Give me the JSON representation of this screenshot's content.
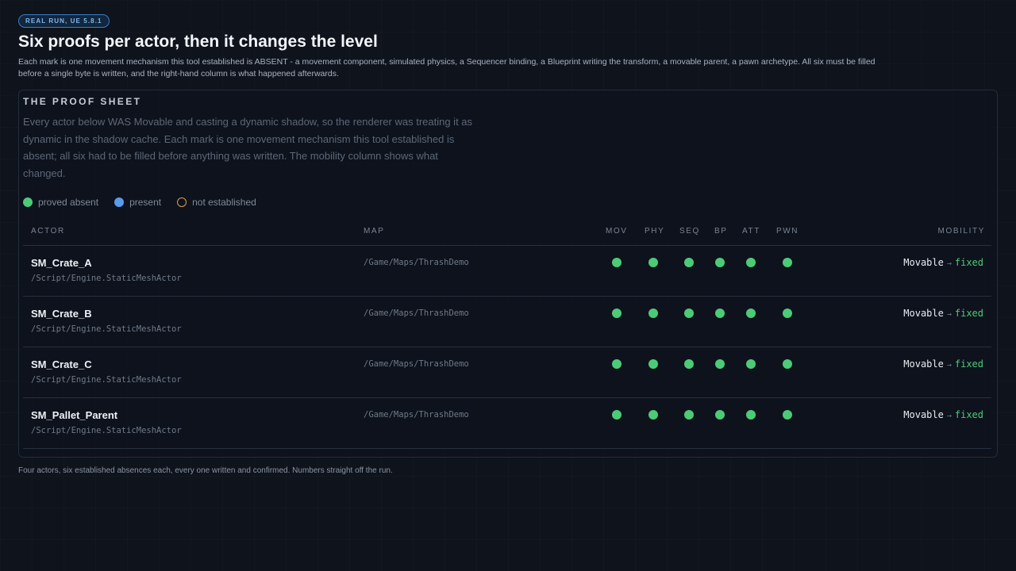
{
  "badge": "REAL RUN, UE 5.8.1",
  "title": "Six proofs per actor, then it changes the level",
  "subtitle": "Each mark is one movement mechanism this tool established is ABSENT - a movement component, simulated physics, a Sequencer binding, a Blueprint writing the transform, a movable parent, a pawn archetype. All six must be filled before a single byte is written, and the right-hand column is what happened afterwards.",
  "card": {
    "title": "THE PROOF SHEET",
    "description": "Every actor below WAS Movable and casting a dynamic shadow, so the renderer was treating it as dynamic in the shadow cache. Each mark is one movement mechanism this tool established is absent; all six had to be filled before anything was written. The mobility column shows what changed."
  },
  "legend": {
    "absent": "proved absent",
    "present": "present",
    "not_established": "not established"
  },
  "colors": {
    "absent": "#4ccb77",
    "present": "#5b9bea",
    "not_established": "#d9a04e"
  },
  "columns": {
    "actor": "ACTOR",
    "map": "MAP",
    "mov": "MOV",
    "phy": "PHY",
    "seq": "SEQ",
    "bp": "BP",
    "att": "ATT",
    "pwn": "PWN",
    "mobility": "MOBILITY"
  },
  "rows": [
    {
      "name": "SM_Crate_A",
      "class": "/Script/Engine.StaticMeshActor",
      "map": "/Game/Maps/ThrashDemo",
      "proofs": [
        "absent",
        "absent",
        "absent",
        "absent",
        "absent",
        "absent"
      ],
      "from": "Movable",
      "arrow": "→",
      "to": "fixed"
    },
    {
      "name": "SM_Crate_B",
      "class": "/Script/Engine.StaticMeshActor",
      "map": "/Game/Maps/ThrashDemo",
      "proofs": [
        "absent",
        "absent",
        "absent",
        "absent",
        "absent",
        "absent"
      ],
      "from": "Movable",
      "arrow": "→",
      "to": "fixed"
    },
    {
      "name": "SM_Crate_C",
      "class": "/Script/Engine.StaticMeshActor",
      "map": "/Game/Maps/ThrashDemo",
      "proofs": [
        "absent",
        "absent",
        "absent",
        "absent",
        "absent",
        "absent"
      ],
      "from": "Movable",
      "arrow": "→",
      "to": "fixed"
    },
    {
      "name": "SM_Pallet_Parent",
      "class": "/Script/Engine.StaticMeshActor",
      "map": "/Game/Maps/ThrashDemo",
      "proofs": [
        "absent",
        "absent",
        "absent",
        "absent",
        "absent",
        "absent"
      ],
      "from": "Movable",
      "arrow": "→",
      "to": "fixed"
    }
  ],
  "footer": "Four actors, six established absences each, every one written and confirmed. Numbers straight off the run."
}
